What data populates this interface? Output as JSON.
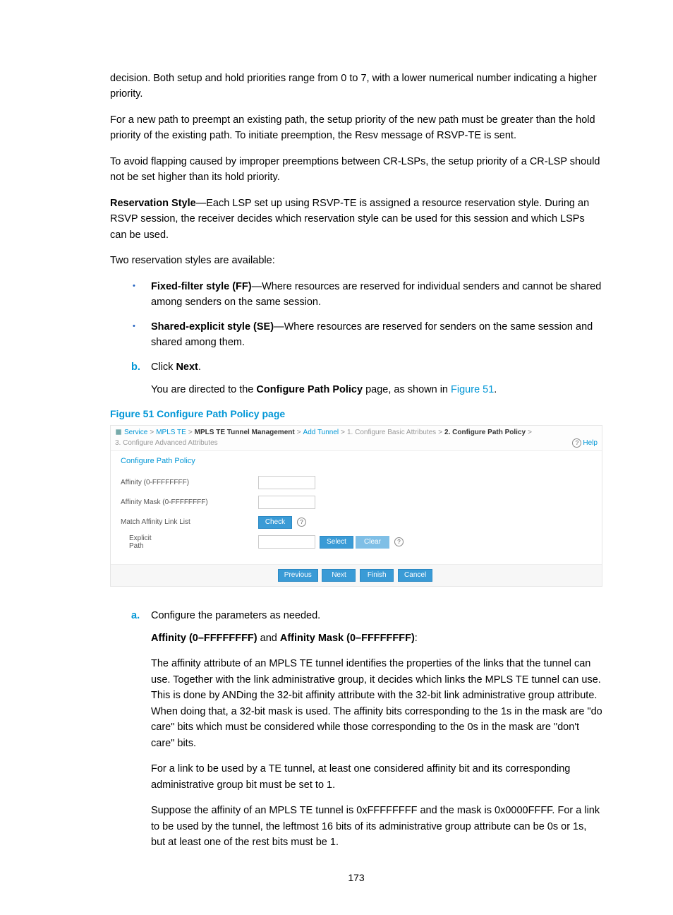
{
  "paragraphs": {
    "p1": "decision. Both setup and hold priorities range from 0 to 7, with a lower numerical number indicating a higher priority.",
    "p2": "For a new path to preempt an existing path, the setup priority of the new path must be greater than the hold priority of the existing path. To initiate preemption, the Resv message of RSVP-TE is sent.",
    "p3": "To avoid flapping caused by improper preemptions between CR-LSPs, the setup priority of a CR-LSP should not be set higher than its hold priority.",
    "p4_bold": "Reservation Style",
    "p4_rest": "—Each LSP set up using RSVP-TE is assigned a resource reservation style. During an RSVP session, the receiver decides which reservation style can be used for this session and which LSPs can be used.",
    "p5": "Two reservation styles are available:",
    "b1_bold": "Fixed-filter style (FF)",
    "b1_rest": "—Where resources are reserved for individual senders and cannot be shared among senders on the same session.",
    "b2_bold": "Shared-explicit style (SE)",
    "b2_rest": "—Where resources are reserved for senders on the same session and shared among them.",
    "stepB_marker": "b.",
    "stepB_pre": "Click ",
    "stepB_bold": "Next",
    "stepB_post": ".",
    "stepB_followup_pre": "You are directed to the ",
    "stepB_followup_bold": "Configure Path Policy",
    "stepB_followup_mid": " page, as shown in ",
    "stepB_followup_link": "Figure 51",
    "stepB_followup_post": ".",
    "fig_title": "Figure 51 Configure Path Policy page",
    "stepA_marker": "a.",
    "stepA_text": "Configure the parameters as needed.",
    "aff_bold1": "Affinity (0–FFFFFFFF)",
    "aff_mid": " and ",
    "aff_bold2": "Affinity Mask (0–FFFFFFFF)",
    "aff_post": ":",
    "p6": "The affinity attribute of an MPLS TE tunnel identifies the properties of the links that the tunnel can use. Together with the link administrative group, it decides which links the MPLS TE tunnel can use. This is done by ANDing the 32-bit affinity attribute with the 32-bit link administrative group attribute. When doing that, a 32-bit mask is used. The affinity bits corresponding to the 1s in the mask are \"do care\" bits which must be considered while those corresponding to the 0s in the mask are \"don't care\" bits.",
    "p7": "For a link to be used by a TE tunnel, at least one considered affinity bit and its corresponding administrative group bit must be set to 1.",
    "p8": "Suppose the affinity of an MPLS TE tunnel is 0xFFFFFFFF and the mask is 0x0000FFFF. For a link to be used by the tunnel, the leftmost 16 bits of its administrative group attribute can be 0s or 1s, but at least one of the rest bits must be 1."
  },
  "breadcrumb": {
    "items": [
      "Service",
      "MPLS TE",
      "MPLS TE Tunnel Management",
      "Add Tunnel",
      "1. Configure Basic Attributes",
      "2. Configure Path Policy",
      "3. Configure Advanced Attributes"
    ],
    "help": "Help"
  },
  "panel": {
    "title": "Configure Path Policy",
    "affinity_label": "Affinity (0-FFFFFFFF)",
    "affinity_mask_label": "Affinity Mask (0-FFFFFFFF)",
    "match_label": "Match Affinity Link List",
    "check_btn": "Check",
    "explicit_label": "Explicit\nPath",
    "select_btn": "Select",
    "clear_btn": "Clear"
  },
  "footer": {
    "previous": "Previous",
    "next": "Next",
    "finish": "Finish",
    "cancel": "Cancel"
  },
  "pagenum": "173"
}
